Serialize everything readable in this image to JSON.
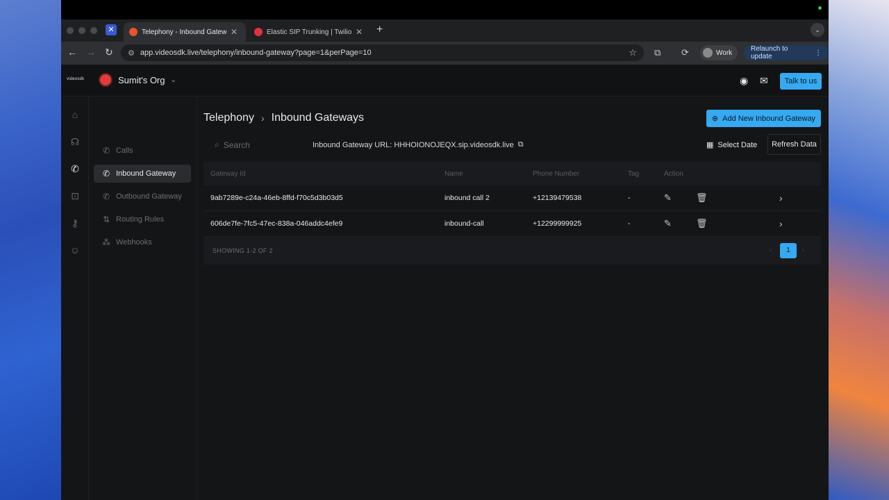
{
  "browser": {
    "tabs": [
      {
        "title": "Telephony - Inbound Gatewa",
        "active": true,
        "favicon_color": "#e8552a"
      },
      {
        "title": "Elastic SIP Trunking | Twilio C",
        "active": false,
        "favicon_color": "#e0323e"
      }
    ],
    "url": "app.videosdk.live/telephony/inbound-gateway?page=1&perPage=10",
    "profile_label": "Work",
    "relaunch_label": "Relaunch to update"
  },
  "header": {
    "logo_text": "videosdk",
    "org_name": "Sumit's Org",
    "talk_label": "Talk to us"
  },
  "sidebar": {
    "items": [
      {
        "label": "Calls",
        "icon": "phone-icon",
        "active": false
      },
      {
        "label": "Inbound Gateway",
        "icon": "phone-incoming-icon",
        "active": true
      },
      {
        "label": "Outbound Gateway",
        "icon": "phone-outgoing-icon",
        "active": false
      },
      {
        "label": "Routing Rules",
        "icon": "routing-icon",
        "active": false
      },
      {
        "label": "Webhooks",
        "icon": "webhook-icon",
        "active": false
      }
    ]
  },
  "main": {
    "breadcrumb": [
      "Telephony",
      "Inbound Gateways"
    ],
    "add_button": "Add New Inbound Gateway",
    "search_placeholder": "Search",
    "gateway_url_label": "Inbound Gateway URL: HHHOIONOJEQX.sip.videosdk.live",
    "select_date_label": "Select Date",
    "refresh_label": "Refresh Data",
    "columns": [
      "Gateway Id",
      "Name",
      "Phone Number",
      "Tag",
      "Action"
    ],
    "rows": [
      {
        "id": "9ab7289e-c24a-46eb-8ffd-f70c5d3b03d5",
        "name": "inbound call 2",
        "phone": "+12139479538",
        "tag": "-"
      },
      {
        "id": "606de7fe-7fc5-47ec-838a-046addc4efe9",
        "name": "inbound-call",
        "phone": "+12299999925",
        "tag": "-"
      }
    ],
    "showing": "SHOWING 1-2 OF 2",
    "current_page": "1"
  },
  "colors": {
    "accent": "#36a9f0",
    "background": "#141517"
  }
}
